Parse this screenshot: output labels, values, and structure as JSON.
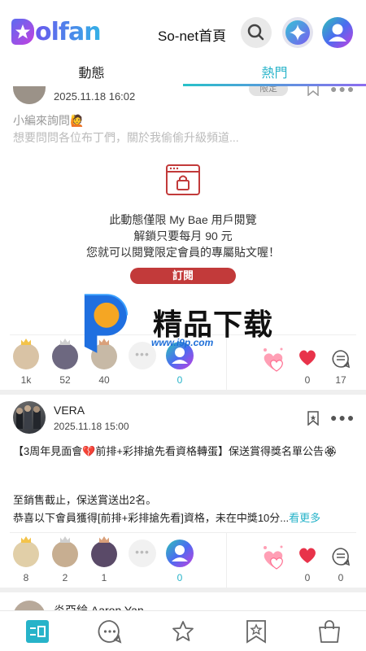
{
  "header": {
    "logo_text": "olfan",
    "home_link": "So-net首頁"
  },
  "tabs": {
    "follow": "動態",
    "hot": "熱門"
  },
  "post1": {
    "time": "2025.11.18 16:02",
    "badge": "限定",
    "line1": "小編來詢問🙋",
    "line2": "想要問問各位布丁們，關於我偷偷升級頻道...",
    "paywall_line1": "此動態僅限 My Bae 用戶閱覽",
    "paywall_line2": "解鎖只要每月 90 元",
    "paywall_line3": "您就可以閱覽限定會員的專屬貼文喔！",
    "subscribe": "訂閱",
    "supporters": [
      "1k",
      "52",
      "40"
    ],
    "my_count": "0",
    "likes": "0",
    "comments": "17"
  },
  "watermark": {
    "title": "精品下载",
    "url": "www.i9p.com"
  },
  "post2": {
    "author": "VERA",
    "time": "2025.11.18 15:00",
    "line1": "【3周年見面會💔前排+彩排搶先看資格轉蛋】保送賞得獎名單公告🏵",
    "line3": "至銷售截止，保送賞送出2名。",
    "line4": "恭喜以下會員獲得[前排+彩排搶先看]資格，未在中獎10分...",
    "see_more": "看更多",
    "supporters": [
      "8",
      "2",
      "1"
    ],
    "my_count": "0",
    "likes": "0",
    "comments": "0"
  },
  "post3": {
    "author": "炎亞綸 Aaron Yan"
  },
  "colors": {
    "accent": "#27b3c9",
    "subscribe": "#c23a3a"
  }
}
